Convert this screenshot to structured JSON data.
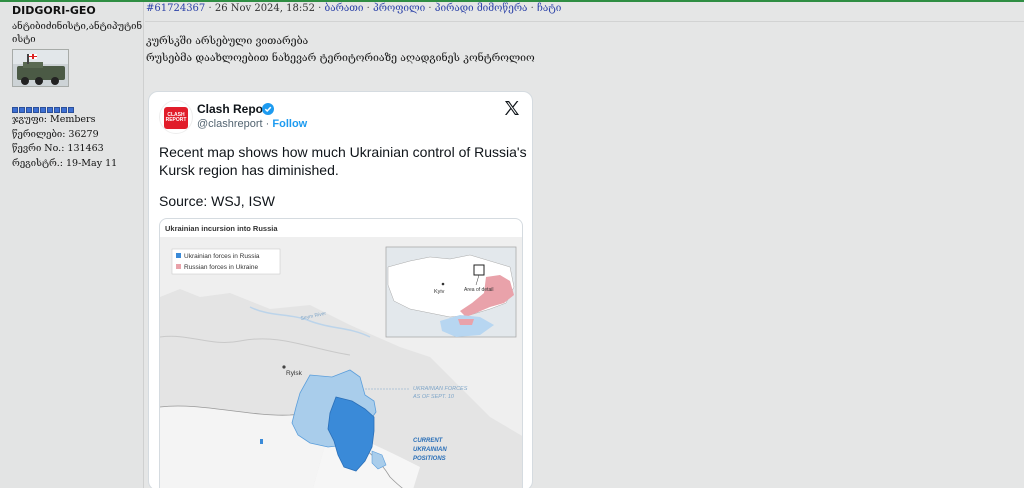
{
  "user": {
    "name": "DIDGORI-GEO",
    "title": "ანტიბიძინისტი,ანტიპუტინ ისტი",
    "stats": [
      "ჯგუფი: Members",
      "წერილები: 36279",
      "წევრი No.: 131463",
      "რეგისტრ.: 19-May 11"
    ],
    "rank_pips": 9
  },
  "post": {
    "id": "#61724367",
    "date": "26 Nov 2024, 18:52",
    "links": [
      "ბარათი",
      "პროფილი",
      "პირადი მიმოწერა",
      "ჩატი"
    ],
    "line1": "კურსკში არსებული ვითარება",
    "line2": "რუსებმა დაახლოებით ნახევარ ტერიტორიაზე აღადგინეს კონტროლიო"
  },
  "tweet": {
    "avatar_text": "CLASH REPORT",
    "name": "Clash Report",
    "handle": "@clashreport",
    "follow": "Follow",
    "text": "Recent map shows how much Ukrainian control of Russia's Kursk region has diminished.",
    "source": "Source: WSJ, ISW",
    "colors": {
      "link": "#1d9bf0",
      "verified": "#1d9bf0"
    }
  },
  "map": {
    "title": "Ukrainian incursion into Russia",
    "legend": [
      "Ukrainian forces in Russia",
      "Russian forces in Ukraine"
    ],
    "inset_labels": [
      "Kyiv",
      "Area of detail"
    ],
    "river": "Seym River",
    "city": "Rylsk",
    "label_sept10": [
      "UKRAINIAN FORCES",
      "AS OF SEPT. 10"
    ],
    "label_current": [
      "CURRENT",
      "UKRAINIAN",
      "POSITIONS"
    ],
    "colors": {
      "ukr_light": "#a9cdeb",
      "ukr_dark": "#3a8ad8",
      "russian": "#e9a2aa",
      "water": "#b7d6f1"
    }
  }
}
